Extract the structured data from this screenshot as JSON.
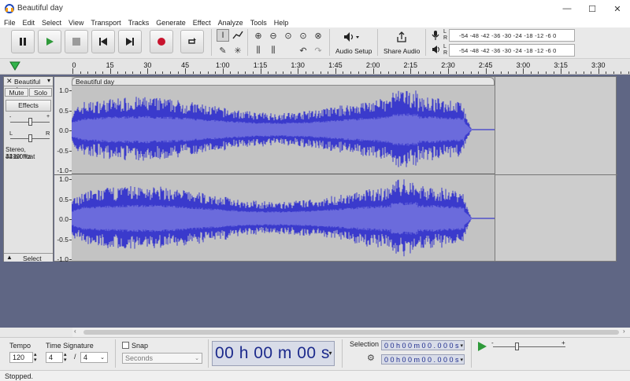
{
  "window": {
    "title": "Beautiful day",
    "minimize": "—",
    "maximize": "☐",
    "close": "✕"
  },
  "menu": [
    "File",
    "Edit",
    "Select",
    "View",
    "Transport",
    "Tracks",
    "Generate",
    "Effect",
    "Analyze",
    "Tools",
    "Help"
  ],
  "toolbar": {
    "audio_setup_label": "Audio Setup",
    "share_audio_label": "Share Audio",
    "meter_record_label": "R",
    "meter_left_label": "L",
    "meter_scale": "-54  -48  -42  -36  -30  -24  -18  -12   -6    0",
    "meter_scale_play": "-54  -48  -42  -36  -30  -24  -18  -12   -6    0"
  },
  "timeline": {
    "ticks": [
      "0",
      "15",
      "30",
      "45",
      "1:00",
      "1:15",
      "1:30",
      "1:45",
      "2:00",
      "2:15",
      "2:30",
      "2:45",
      "3:00",
      "3:15",
      "3:30"
    ]
  },
  "track": {
    "name": "Beautiful day",
    "mute": "Mute",
    "solo": "Solo",
    "effects": "Effects",
    "pan_left": "L",
    "pan_right": "R",
    "info_line1": "Stereo, 44100Hz",
    "info_line2": "32-bit float",
    "select": "Select",
    "clip_name": "Beautiful day",
    "ruler_top": [
      "1.0",
      "0.5",
      "0.0",
      "-0.5",
      "-1.0"
    ],
    "ruler_bottom": [
      "1.0",
      "0.5",
      "0.0",
      "-0.5",
      "-1.0"
    ]
  },
  "bottom": {
    "tempo_label": "Tempo",
    "tempo_value": "120",
    "timesig_label": "Time Signature",
    "timesig_num": "4",
    "timesig_slash": "/",
    "timesig_den": "4",
    "snap_label": "Snap",
    "snap_unit": "Seconds",
    "time_display": "00 h 00 m 00 s",
    "selection_label": "Selection",
    "selection_start": "0 0 h 0 0 m 0 0 . 0 0 0 s",
    "selection_end": "0 0 h 0 0 m 0 0 . 0 0 0 s"
  },
  "status": "Stopped.",
  "colors": {
    "waveform": "#3a3acc",
    "waveform_rms": "#6b6bdc",
    "track_bg": "#5f6684",
    "record": "#c8142e",
    "play": "#2f9a3a"
  }
}
